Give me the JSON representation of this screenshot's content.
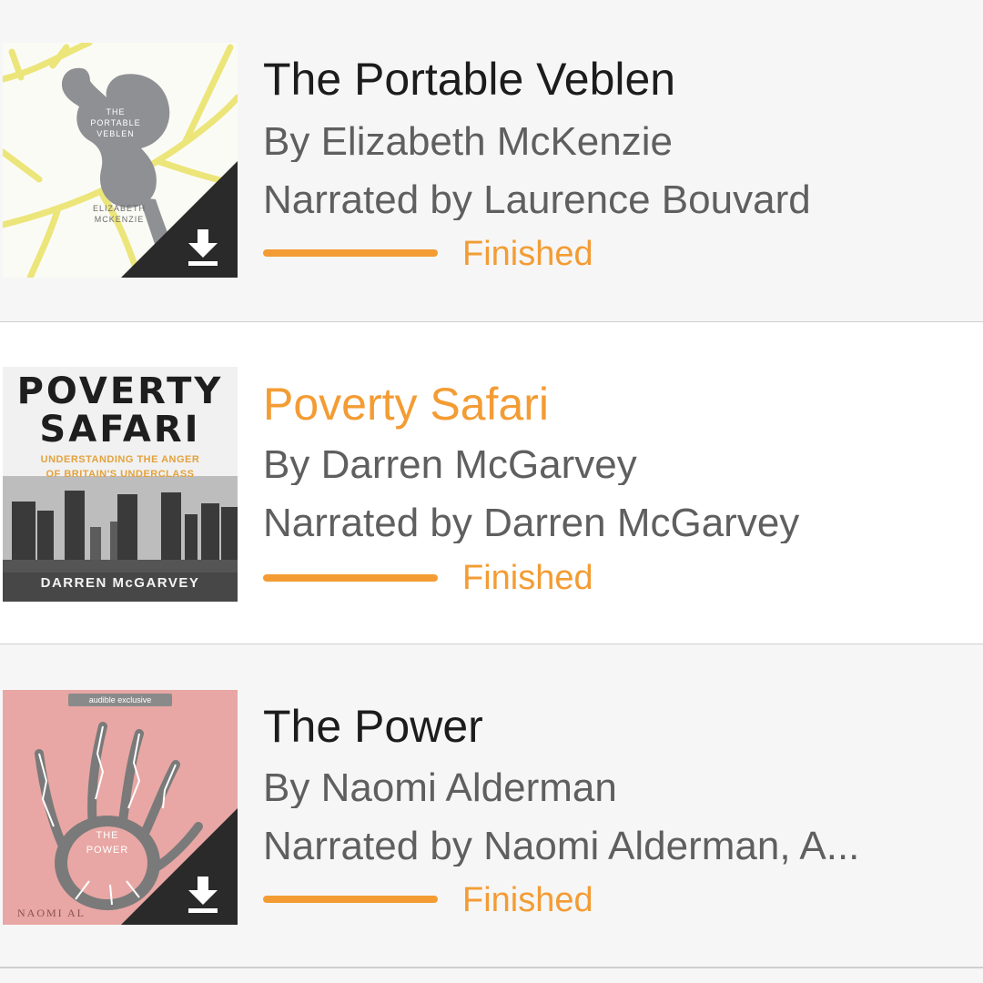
{
  "colors": {
    "accent": "#f39c34",
    "title_text": "#1c1c1c",
    "secondary_text": "#5f5f5f",
    "divider": "#cfcfcf",
    "row_background": "#f6f6f6",
    "selected_row_background": "#ffffff"
  },
  "books": [
    {
      "title": "The Portable Veblen",
      "author": "By Elizabeth McKenzie",
      "narrator": "Narrated by Laurence Bouvard",
      "status": "Finished",
      "progress_fraction": 1.0,
      "selected": false,
      "downloadable": true,
      "download_icon": "download-icon",
      "cover": {
        "title_line_1": "THE",
        "title_line_2": "PORTABLE",
        "title_line_3": "VEBLEN",
        "author_line_1": "ELIZABETH",
        "author_line_2": "MCKENZIE"
      }
    },
    {
      "title": "Poverty Safari",
      "author": "By Darren McGarvey",
      "narrator": "Narrated by Darren McGarvey",
      "status": "Finished",
      "progress_fraction": 1.0,
      "selected": true,
      "downloadable": false,
      "cover": {
        "title_line_1": "POVERTY",
        "title_line_2": "SAFARI",
        "subtitle_line_1": "UNDERSTANDING THE ANGER",
        "subtitle_line_2": "OF BRITAIN'S UNDERCLASS",
        "author": "DARREN McGARVEY"
      }
    },
    {
      "title": "The Power",
      "author": "By Naomi Alderman",
      "narrator": "Narrated by Naomi Alderman, A...",
      "status": "Finished",
      "progress_fraction": 1.0,
      "selected": false,
      "downloadable": true,
      "download_icon": "download-icon",
      "cover": {
        "badge": "audible exclusive",
        "title_line_1": "THE",
        "title_line_2": "POWER",
        "author": "NAOMI AL"
      }
    }
  ]
}
